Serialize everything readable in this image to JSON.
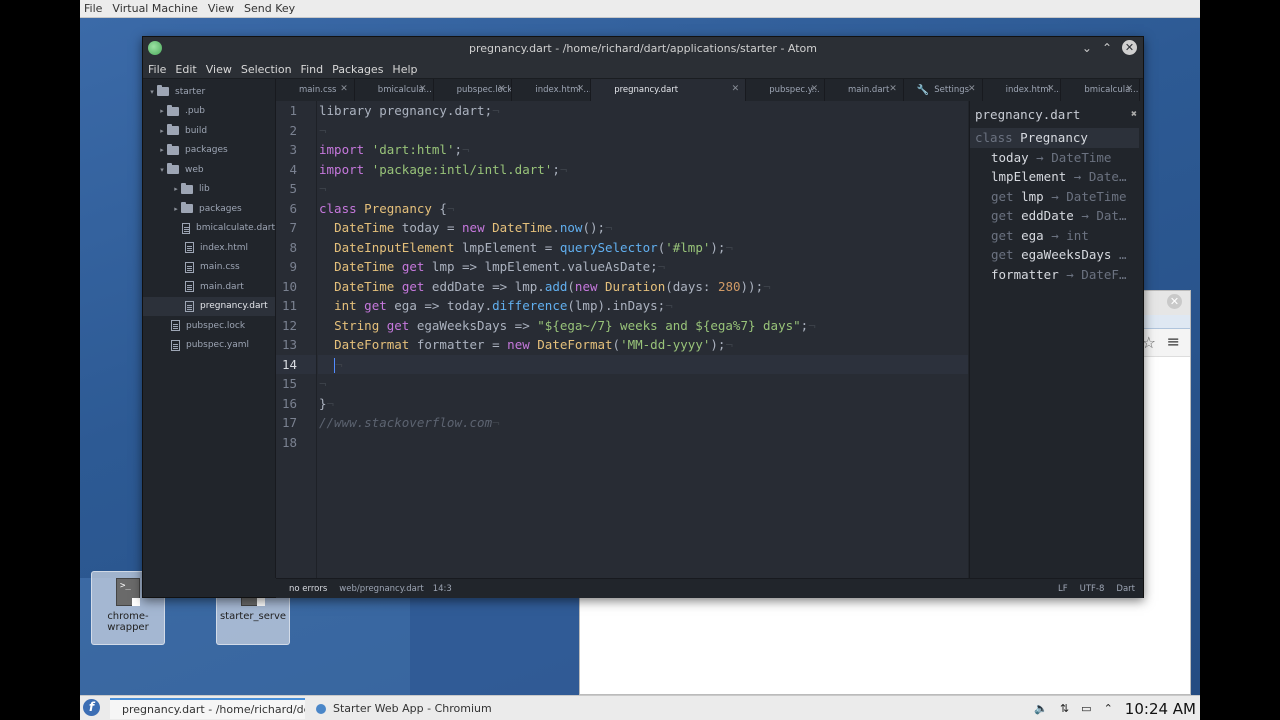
{
  "vm_menu": [
    "File",
    "Virtual Machine",
    "View",
    "Send Key"
  ],
  "atom": {
    "title": "pregnancy.dart - /home/richard/dart/applications/starter - Atom",
    "menu": [
      "File",
      "Edit",
      "View",
      "Selection",
      "Find",
      "Packages",
      "Help"
    ],
    "tree": [
      {
        "label": "starter",
        "kind": "folder",
        "depth": 0,
        "arrow": "▾"
      },
      {
        "label": ".pub",
        "kind": "folder",
        "depth": 1,
        "arrow": "▸"
      },
      {
        "label": "build",
        "kind": "folder",
        "depth": 1,
        "arrow": "▸"
      },
      {
        "label": "packages",
        "kind": "folder",
        "depth": 1,
        "arrow": "▸"
      },
      {
        "label": "web",
        "kind": "folder",
        "depth": 1,
        "arrow": "▾"
      },
      {
        "label": "lib",
        "kind": "folder",
        "depth": 2,
        "arrow": "▸"
      },
      {
        "label": "packages",
        "kind": "folder",
        "depth": 2,
        "arrow": "▸"
      },
      {
        "label": "bmicalculate.dart",
        "kind": "file",
        "depth": 2
      },
      {
        "label": "index.html",
        "kind": "file",
        "depth": 2
      },
      {
        "label": "main.css",
        "kind": "file",
        "depth": 2
      },
      {
        "label": "main.dart",
        "kind": "file",
        "depth": 2
      },
      {
        "label": "pregnancy.dart",
        "kind": "file",
        "depth": 2,
        "selected": true
      },
      {
        "label": "pubspec.lock",
        "kind": "file",
        "depth": 1
      },
      {
        "label": "pubspec.yaml",
        "kind": "file",
        "depth": 1
      }
    ],
    "tabs": [
      {
        "label": "main.css"
      },
      {
        "label": "bmicalcula..."
      },
      {
        "label": "pubspec.lock"
      },
      {
        "label": "index.html ..."
      },
      {
        "label": "pregnancy.dart",
        "active": true
      },
      {
        "label": "pubspec.y..."
      },
      {
        "label": "main.dart"
      },
      {
        "label": "Settings",
        "icon": "wrench-icon"
      },
      {
        "label": "index.html ..."
      },
      {
        "label": "bmicalcula..."
      }
    ],
    "current_line": 14,
    "code": [
      [
        [
          "",
          "library pregnancy.dart;"
        ],
        [
          "eol",
          "¬"
        ]
      ],
      [
        [
          "eol",
          "¬"
        ]
      ],
      [
        [
          "kw",
          "import"
        ],
        [
          "",
          " "
        ],
        [
          "str",
          "'dart:html'"
        ],
        [
          "",
          ";"
        ],
        [
          "eol",
          "¬"
        ]
      ],
      [
        [
          "kw",
          "import"
        ],
        [
          "",
          " "
        ],
        [
          "str",
          "'package:intl/intl.dart'"
        ],
        [
          "",
          ";"
        ],
        [
          "eol",
          "¬"
        ]
      ],
      [
        [
          "eol",
          "¬"
        ]
      ],
      [
        [
          "kw",
          "class"
        ],
        [
          "",
          " "
        ],
        [
          "ty",
          "Pregnancy"
        ],
        [
          "",
          " {"
        ],
        [
          "eol",
          "¬"
        ]
      ],
      [
        [
          "",
          "  "
        ],
        [
          "ty",
          "DateTime"
        ],
        [
          "",
          " today = "
        ],
        [
          "kw",
          "new"
        ],
        [
          "",
          " "
        ],
        [
          "ty",
          "DateTime"
        ],
        [
          "",
          "."
        ],
        [
          "fn",
          "now"
        ],
        [
          "",
          "();"
        ],
        [
          "eol",
          "¬"
        ]
      ],
      [
        [
          "",
          "  "
        ],
        [
          "ty",
          "DateInputElement"
        ],
        [
          "",
          " lmpElement = "
        ],
        [
          "fn",
          "querySelector"
        ],
        [
          "",
          "("
        ],
        [
          "str",
          "'#lmp'"
        ],
        [
          "",
          ");"
        ],
        [
          "eol",
          "¬"
        ]
      ],
      [
        [
          "",
          "  "
        ],
        [
          "ty",
          "DateTime"
        ],
        [
          "",
          " "
        ],
        [
          "kw",
          "get"
        ],
        [
          "",
          " lmp => lmpElement.valueAsDate;"
        ],
        [
          "eol",
          "¬"
        ]
      ],
      [
        [
          "",
          "  "
        ],
        [
          "ty",
          "DateTime"
        ],
        [
          "",
          " "
        ],
        [
          "kw",
          "get"
        ],
        [
          "",
          " eddDate => lmp."
        ],
        [
          "fn",
          "add"
        ],
        [
          "",
          "("
        ],
        [
          "kw",
          "new"
        ],
        [
          "",
          " "
        ],
        [
          "ty",
          "Duration"
        ],
        [
          "",
          "(days: "
        ],
        [
          "num",
          "280"
        ],
        [
          "",
          "));"
        ],
        [
          "eol",
          "¬"
        ]
      ],
      [
        [
          "",
          "  "
        ],
        [
          "ty",
          "int"
        ],
        [
          "",
          " "
        ],
        [
          "kw",
          "get"
        ],
        [
          "",
          " ega => today."
        ],
        [
          "fn",
          "difference"
        ],
        [
          "",
          "(lmp).inDays;"
        ],
        [
          "eol",
          "¬"
        ]
      ],
      [
        [
          "",
          "  "
        ],
        [
          "ty",
          "String"
        ],
        [
          "",
          " "
        ],
        [
          "kw",
          "get"
        ],
        [
          "",
          " egaWeeksDays => "
        ],
        [
          "str",
          "\"${ega~/7} weeks and ${ega%7} days\""
        ],
        [
          "",
          ";"
        ],
        [
          "eol",
          "¬"
        ]
      ],
      [
        [
          "",
          "  "
        ],
        [
          "ty",
          "DateFormat"
        ],
        [
          "",
          " formatter = "
        ],
        [
          "kw",
          "new"
        ],
        [
          "",
          " "
        ],
        [
          "ty",
          "DateFormat"
        ],
        [
          "",
          "("
        ],
        [
          "str",
          "'MM-dd-yyyy'"
        ],
        [
          "",
          ");"
        ],
        [
          "eol",
          "¬"
        ]
      ],
      [
        [
          "",
          "  "
        ],
        [
          "cursor",
          ""
        ],
        [
          "eol",
          "¬"
        ]
      ],
      [
        [
          "eol",
          "¬"
        ]
      ],
      [
        [
          "",
          "}"
        ],
        [
          "eol",
          "¬"
        ]
      ],
      [
        [
          "cm",
          "//www.stackoverflow.com"
        ],
        [
          "eol",
          "¬"
        ]
      ],
      []
    ],
    "outline": {
      "title": "pregnancy.dart",
      "items": [
        {
          "kw": "class",
          "name": "Pregnancy",
          "type": "",
          "indent": false,
          "selected": true
        },
        {
          "kw": "",
          "name": "today",
          "type": " → DateTime",
          "indent": true
        },
        {
          "kw": "",
          "name": "lmpElement",
          "type": " → Date…",
          "indent": true
        },
        {
          "kw": "get",
          "name": "lmp",
          "type": " → DateTime",
          "indent": true
        },
        {
          "kw": "get",
          "name": "eddDate",
          "type": " → Dat…",
          "indent": true
        },
        {
          "kw": "get",
          "name": "ega",
          "type": " → int",
          "indent": true
        },
        {
          "kw": "get",
          "name": "egaWeeksDays",
          "type": " …",
          "indent": true
        },
        {
          "kw": "",
          "name": "formatter",
          "type": " → DateF…",
          "indent": true
        }
      ]
    },
    "status": {
      "errors": "no errors",
      "path": "web/pregnancy.dart",
      "position": "14:3",
      "eol": "LF",
      "encoding": "UTF-8",
      "grammar": "Dart"
    }
  },
  "desktop_icons": [
    {
      "label": "chrome-wrapper"
    },
    {
      "label": "starter_serve"
    }
  ],
  "taskbar": {
    "tasks": [
      {
        "label": "pregnancy.dart - /home/richard/de",
        "active": true,
        "color": "#5fb760"
      },
      {
        "label": "Starter Web App - Chromium",
        "active": false,
        "color": "#4a86c8"
      }
    ],
    "clock": "10:24 AM"
  }
}
